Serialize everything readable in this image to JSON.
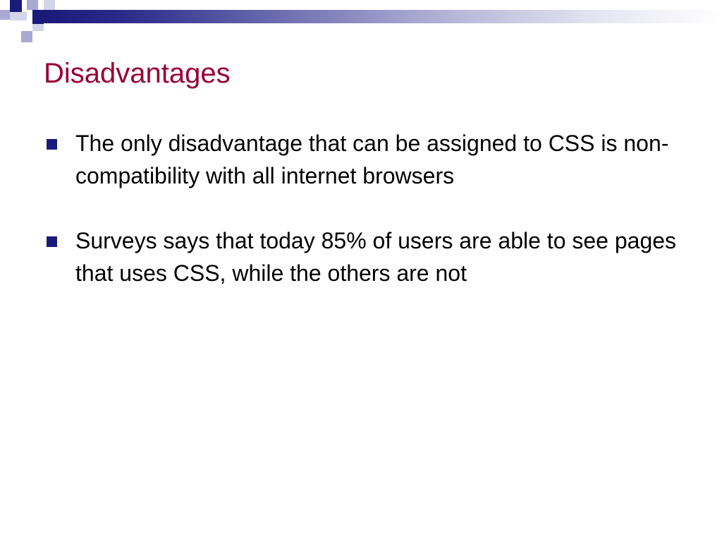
{
  "slide": {
    "title": "Disadvantages",
    "bullets": [
      {
        "text": "The only disadvantage that can be assigned to CSS is non-compatibility with all internet browsers"
      },
      {
        "text": "Surveys says that today 85% of users are able to see pages that uses CSS, while the others are not"
      }
    ]
  },
  "colors": {
    "title": "#990033",
    "accent": "#1a1a7a",
    "accent_light": "#a9a9d4",
    "text": "#000000",
    "background": "#ffffff"
  },
  "icons": {
    "bullet": "square-bullet-icon"
  }
}
